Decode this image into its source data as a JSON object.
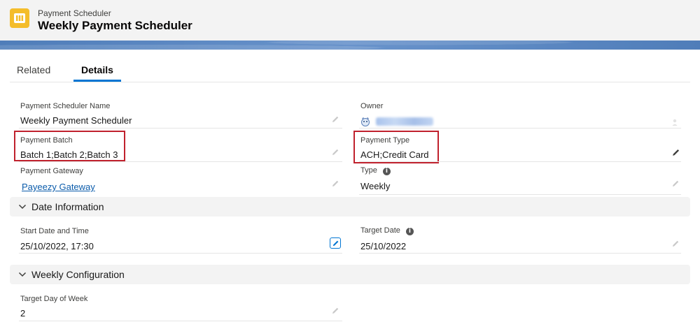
{
  "header": {
    "object_label": "Payment Scheduler",
    "record_title": "Weekly Payment Scheduler",
    "app_icon": "scheduler-app-icon",
    "accent_color": "#f4bd2b"
  },
  "tabs": [
    {
      "label": "Related",
      "active": false
    },
    {
      "label": "Details",
      "active": true
    }
  ],
  "details": {
    "scheduler_name": {
      "label": "Payment Scheduler Name",
      "value": "Weekly Payment Scheduler"
    },
    "owner": {
      "label": "Owner",
      "value_redacted": true
    },
    "payment_batch": {
      "label": "Payment Batch",
      "value": "Batch 1;Batch 2;Batch 3",
      "highlighted": true
    },
    "payment_type": {
      "label": "Payment Type",
      "value": "ACH;Credit Card",
      "highlighted": true
    },
    "payment_gateway": {
      "label": "Payment Gateway",
      "value": "Payeezy Gateway"
    },
    "type": {
      "label": "Type",
      "value": "Weekly"
    }
  },
  "sections": {
    "date_information": {
      "title": "Date Information",
      "start_date": {
        "label": "Start Date and Time",
        "value": "25/10/2022, 17:30"
      },
      "target_date": {
        "label": "Target Date",
        "value": "25/10/2022"
      }
    },
    "weekly_configuration": {
      "title": "Weekly Configuration",
      "target_day": {
        "label": "Target Day of Week",
        "value": "2"
      }
    }
  },
  "colors": {
    "brand_blue": "#0176d3",
    "link": "#0b5cab",
    "highlight_border": "#c0212d"
  }
}
